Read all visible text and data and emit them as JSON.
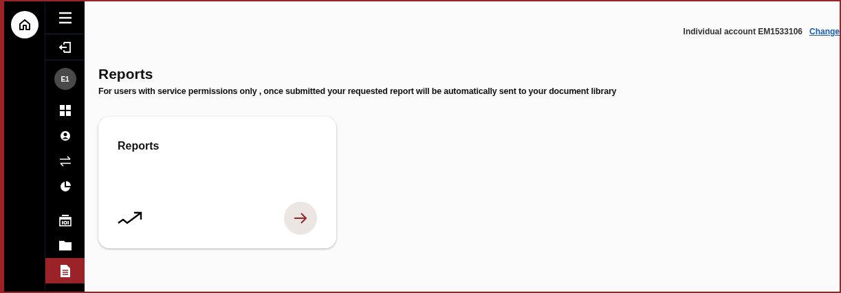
{
  "sidebar": {
    "home": {
      "selected": false
    },
    "items": [
      {
        "kind": "menu",
        "selected": false
      },
      {
        "kind": "logout",
        "selected": false
      },
      {
        "kind": "avatar",
        "label": "E1",
        "selected": false
      },
      {
        "kind": "dashboard",
        "selected": false
      },
      {
        "kind": "profile",
        "selected": false
      },
      {
        "kind": "transfer",
        "selected": false
      },
      {
        "kind": "chart",
        "selected": false
      },
      {
        "kind": "printer",
        "selected": false
      },
      {
        "kind": "folder",
        "selected": false
      },
      {
        "kind": "document",
        "selected": true
      }
    ]
  },
  "account": {
    "text": "Individual account EM1533106",
    "link": "Change"
  },
  "page": {
    "title": "Reports",
    "subtitle": "For users with service permissions only , once submitted your requested report will be automatically sent to your document library"
  },
  "cards": [
    {
      "title": "Reports"
    }
  ]
}
